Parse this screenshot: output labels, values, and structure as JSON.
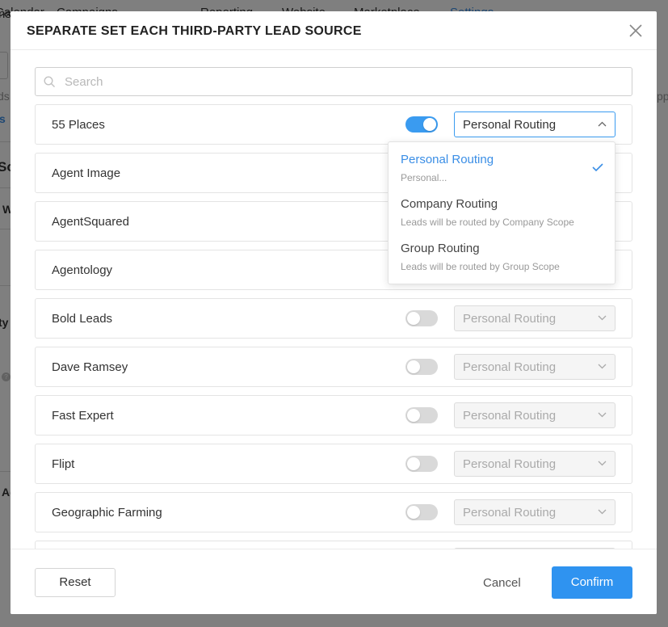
{
  "background": {
    "nav_tabs": [
      "Calendar",
      "Campaigns",
      "Reporting",
      "Website",
      "Marketplace",
      "Settings"
    ],
    "active_tab": "Settings",
    "fragments": {
      "left_a": "ns",
      "left_b": "ds",
      "left_c": "s",
      "left_d": "So",
      "left_e": "W",
      "left_f": "ty",
      "left_g": "Ad",
      "right_a": "pp"
    }
  },
  "modal": {
    "title": "SEPARATE SET EACH THIRD-PARTY LEAD SOURCE",
    "search": {
      "placeholder": "Search",
      "value": ""
    },
    "sources": [
      {
        "name": "55 Places",
        "enabled": true,
        "routing": "Personal Routing"
      },
      {
        "name": "Agent Image",
        "enabled": false,
        "routing": "Personal Routing"
      },
      {
        "name": "AgentSquared",
        "enabled": false,
        "routing": "Personal Routing"
      },
      {
        "name": "Agentology",
        "enabled": false,
        "routing": "Personal Routing"
      },
      {
        "name": "Bold Leads",
        "enabled": false,
        "routing": "Personal Routing"
      },
      {
        "name": "Dave Ramsey",
        "enabled": false,
        "routing": "Personal Routing"
      },
      {
        "name": "Fast Expert",
        "enabled": false,
        "routing": "Personal Routing"
      },
      {
        "name": "Flipt",
        "enabled": false,
        "routing": "Personal Routing"
      },
      {
        "name": "Geographic Farming",
        "enabled": false,
        "routing": "Personal Routing"
      },
      {
        "name": "",
        "enabled": false,
        "routing": ""
      }
    ],
    "dropdown": {
      "options": [
        {
          "label": "Personal Routing",
          "description": "Personal...",
          "selected": true
        },
        {
          "label": "Company Routing",
          "description": "Leads will be routed by Company Scope",
          "selected": false
        },
        {
          "label": "Group Routing",
          "description": "Leads will be routed by Group Scope",
          "selected": false
        }
      ]
    },
    "footer": {
      "reset_label": "Reset",
      "cancel_label": "Cancel",
      "confirm_label": "Confirm"
    }
  },
  "colors": {
    "accent": "#3a9bf0",
    "primary_button": "#2f93f0",
    "selected_text": "#3a8ee6"
  }
}
